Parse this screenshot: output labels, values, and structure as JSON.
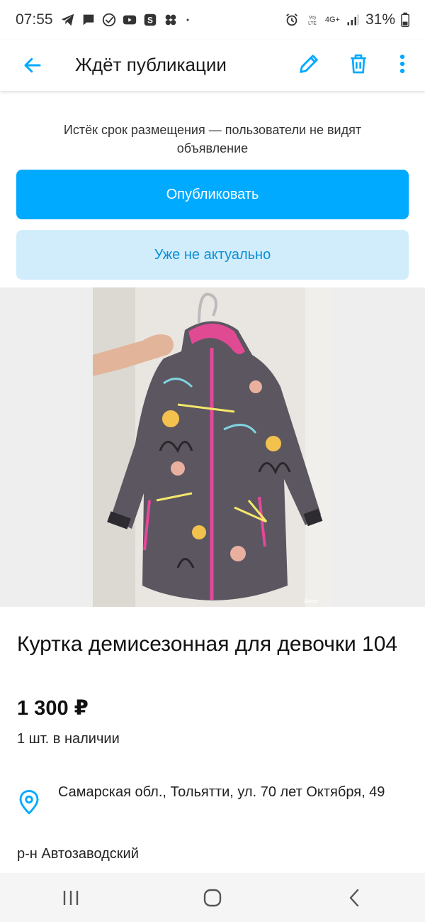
{
  "status_bar": {
    "time": "07:55",
    "notification_icons": [
      "telegram-icon",
      "chat-bubble-icon",
      "check-circle-icon",
      "youtube-icon",
      "s-app-icon",
      "flower-app-icon",
      "dot-icon"
    ],
    "network_label": "4G+",
    "battery": "31%"
  },
  "app_bar": {
    "title": "Ждёт публикации",
    "accent_color": "#00aaff"
  },
  "listing": {
    "notice": "Истёк срок размещения — пользователи не видят объявление",
    "publish_label": "Опубликовать",
    "not_relevant_label": "Уже не актуально",
    "title": "Куртка демисезонная для девочки 104",
    "price": "1 300 ₽",
    "stock": "1 шт. в наличии",
    "address": "Самарская обл., Тольятти, ул. 70 лет Октября, 49",
    "district": "р-н Автозаводский",
    "photo_watermark": "Avito"
  },
  "colors": {
    "primary": "#00aaff",
    "secondary_bg": "#d1edfc",
    "secondary_text": "#0a8fd6"
  }
}
